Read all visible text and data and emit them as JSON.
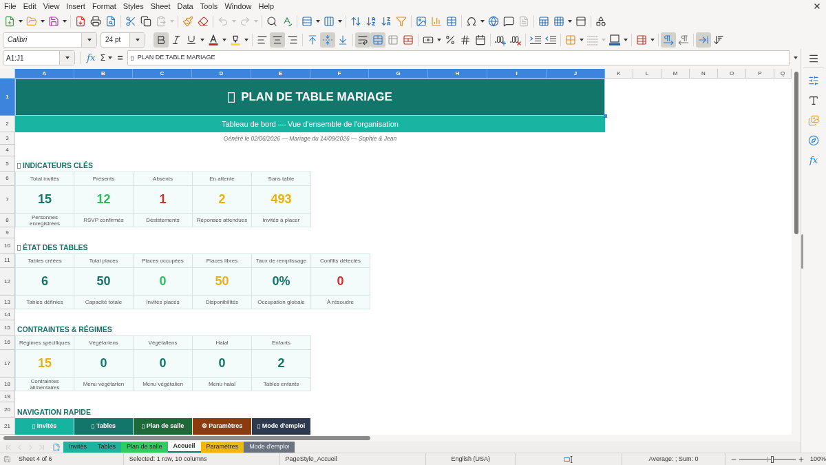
{
  "menu_bar": {
    "items": [
      "File",
      "Edit",
      "View",
      "Insert",
      "Format",
      "Styles",
      "Sheet",
      "Data",
      "Tools",
      "Window",
      "Help"
    ]
  },
  "standard_toolbar": {
    "paste": {
      "disabled": true
    },
    "undo": {
      "disabled": true
    },
    "redo": {
      "disabled": true
    },
    "headers_footers": {
      "disabled": true
    }
  },
  "formatting_toolbar": {
    "font_name": "Calibri",
    "font_size": "24 pt",
    "toggles": {
      "bold": true,
      "italic": false,
      "underline": false,
      "align_left": false,
      "align_center": true,
      "align_right": false,
      "align_top": false,
      "align_middle": true,
      "align_bottom": false,
      "wrap_text": true,
      "merge_center": true,
      "left_to_right": true,
      "right_to_left": false,
      "text_left_to_right": true,
      "text_top_to_bottom": false
    },
    "border_style": {
      "disabled": true
    }
  },
  "formula_bar": {
    "name_box": "A1:J1",
    "function_wizard": "fx",
    "sum": "Σ",
    "equals": "=",
    "content": {
      "text": "PLAN DE TABLE MARIAGE",
      "missing_glyph": true
    }
  },
  "sidebar": {
    "functions": "fx"
  },
  "sheet": {
    "columns": [
      {
        "label": "A",
        "selected": true
      },
      {
        "label": "B",
        "selected": true
      },
      {
        "label": "C",
        "selected": true
      },
      {
        "label": "D",
        "selected": true
      },
      {
        "label": "E",
        "selected": true
      },
      {
        "label": "F",
        "selected": true
      },
      {
        "label": "G",
        "selected": true
      },
      {
        "label": "H",
        "selected": true
      },
      {
        "label": "I",
        "selected": true
      },
      {
        "label": "J",
        "selected": true
      },
      {
        "label": "K",
        "selected": false
      },
      {
        "label": "L",
        "selected": false
      },
      {
        "label": "M",
        "selected": false
      },
      {
        "label": "N",
        "selected": false
      },
      {
        "label": "O",
        "selected": false
      },
      {
        "label": "P",
        "selected": false
      },
      {
        "label": "Q",
        "selected": false
      }
    ],
    "rows": [
      {
        "label": "1",
        "selected": true
      },
      {
        "label": "2",
        "selected": false
      },
      {
        "label": "3",
        "selected": false
      },
      {
        "label": "4",
        "selected": false
      },
      {
        "label": "5",
        "selected": false
      },
      {
        "label": "6",
        "selected": false
      },
      {
        "label": "7",
        "selected": false
      },
      {
        "label": "8",
        "selected": false
      },
      {
        "label": "9",
        "selected": false
      },
      {
        "label": "10",
        "selected": false
      },
      {
        "label": "11",
        "selected": false
      },
      {
        "label": "12",
        "selected": false
      },
      {
        "label": "13",
        "selected": false
      },
      {
        "label": "14",
        "selected": false
      },
      {
        "label": "15",
        "selected": false
      },
      {
        "label": "16",
        "selected": false
      },
      {
        "label": "17",
        "selected": false
      },
      {
        "label": "18",
        "selected": false
      },
      {
        "label": "19",
        "selected": false
      },
      {
        "label": "20",
        "selected": false
      },
      {
        "label": "21",
        "selected": false
      }
    ],
    "title": {
      "text": "PLAN DE TABLE MARIAGE",
      "missing_glyph": true
    },
    "subtitle": "Tableau de bord — Vue d'ensemble de l'organisation",
    "generated": "Généré le 02/06/2026 — Mariage du 14/09/2026 — Sophie & Jean",
    "sections": [
      {
        "heading": "INDICATEURS CLÉS",
        "missing_glyph": true,
        "cards": [
          {
            "label": "Total invités",
            "value": "15",
            "color": "#14766b",
            "caption": "Personnes enregistrées"
          },
          {
            "label": "Présents",
            "value": "12",
            "color": "#2dbd5e",
            "caption": "RSVP confirmés"
          },
          {
            "label": "Absents",
            "value": "1",
            "color": "#d0302b",
            "caption": "Désistements"
          },
          {
            "label": "En attente",
            "value": "2",
            "color": "#e8b10d",
            "caption": "Réponses attendues"
          },
          {
            "label": "Sans table",
            "value": "493",
            "color": "#e8b10d",
            "caption": "Invités à placer"
          }
        ]
      },
      {
        "heading": "ÉTAT DES TABLES",
        "missing_glyph": true,
        "cards": [
          {
            "label": "Tables créées",
            "value": "6",
            "color": "#14766b",
            "caption": "Tables définies"
          },
          {
            "label": "Total places",
            "value": "50",
            "color": "#14766b",
            "caption": "Capacité totale"
          },
          {
            "label": "Places occupées",
            "value": "0",
            "color": "#2dbd5e",
            "caption": "Invités placés"
          },
          {
            "label": "Places libres",
            "value": "50",
            "color": "#e8b10d",
            "caption": "Disponibilités"
          },
          {
            "label": "Taux de remplissage",
            "value": "0%",
            "color": "#14766b",
            "caption": "Occupation globale"
          },
          {
            "label": "Conflits détectés",
            "value": "0",
            "color": "#d0302b",
            "caption": "À résoudre"
          }
        ]
      },
      {
        "heading": "CONTRAINTES & RÉGIMES",
        "missing_glyph": false,
        "cards": [
          {
            "label": "Régimes spécifiques",
            "value": "15",
            "color": "#e8b10d",
            "caption": "Contraintes alimentaires"
          },
          {
            "label": "Végétariens",
            "value": "0",
            "color": "#14766b",
            "caption": "Menu végétarien"
          },
          {
            "label": "Végétaliens",
            "value": "0",
            "color": "#14766b",
            "caption": "Menu végétalien"
          },
          {
            "label": "Halal",
            "value": "0",
            "color": "#14766b",
            "caption": "Menu halal"
          },
          {
            "label": "Enfants",
            "value": "2",
            "color": "#14766b",
            "caption": "Tables enfants"
          }
        ]
      }
    ],
    "navigation": {
      "heading": "NAVIGATION RAPIDE",
      "missing_glyph": false,
      "buttons": [
        {
          "label": "Invités",
          "missing_glyph": true,
          "color": "#17b3a0"
        },
        {
          "label": "Tables",
          "missing_glyph": true,
          "color": "#13766b"
        },
        {
          "label": "Plan de salle",
          "missing_glyph": true,
          "color": "#1c6a3a"
        },
        {
          "label": "⚙ Paramètres",
          "missing_glyph": false,
          "color": "#8c3b0f"
        },
        {
          "label": "Mode d'emploi",
          "missing_glyph": true,
          "color": "#2d3a4e"
        }
      ]
    }
  },
  "sheet_tabs": {
    "navigation_disabled": true,
    "tabs": [
      {
        "label": "Invités",
        "color": "#1db39f",
        "selected": false
      },
      {
        "label": "Tables",
        "color": "#1db39f",
        "selected": false
      },
      {
        "label": "Plan de salle",
        "color": "#2fcc66",
        "selected": false
      },
      {
        "label": "Accueil",
        "color": "#13766b",
        "selected": true
      },
      {
        "label": "Paramètres",
        "color": "#f1b80b",
        "selected": false
      },
      {
        "label": "Mode d'emploi",
        "color": "#6b7280",
        "selected": false
      }
    ]
  },
  "status_bar": {
    "sheet": "Sheet 4 of 6",
    "selection": "Selected: 1 row, 10 columns",
    "page_style": "PageStyle_Accueil",
    "language": "English (USA)",
    "summary": "Average: ; Sum: 0",
    "zoom": {
      "level": 0.58,
      "reading": "100%"
    }
  }
}
